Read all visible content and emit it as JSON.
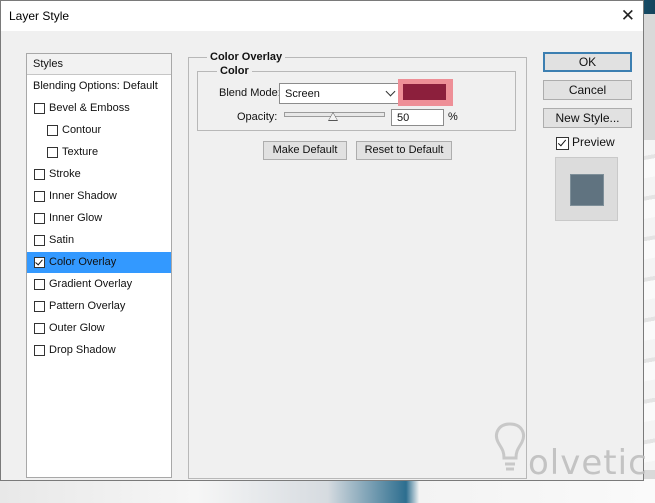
{
  "window": {
    "title": "Layer Style",
    "close_glyph": "✕"
  },
  "styles_panel": {
    "header": "Styles",
    "items": [
      {
        "label": "Blending Options: Default",
        "checkbox": false,
        "checked": false,
        "indent": false,
        "selected": false
      },
      {
        "label": "Bevel & Emboss",
        "checkbox": true,
        "checked": false,
        "indent": false,
        "selected": false
      },
      {
        "label": "Contour",
        "checkbox": true,
        "checked": false,
        "indent": true,
        "selected": false
      },
      {
        "label": "Texture",
        "checkbox": true,
        "checked": false,
        "indent": true,
        "selected": false
      },
      {
        "label": "Stroke",
        "checkbox": true,
        "checked": false,
        "indent": false,
        "selected": false
      },
      {
        "label": "Inner Shadow",
        "checkbox": true,
        "checked": false,
        "indent": false,
        "selected": false
      },
      {
        "label": "Inner Glow",
        "checkbox": true,
        "checked": false,
        "indent": false,
        "selected": false
      },
      {
        "label": "Satin",
        "checkbox": true,
        "checked": false,
        "indent": false,
        "selected": false
      },
      {
        "label": "Color Overlay",
        "checkbox": true,
        "checked": true,
        "indent": false,
        "selected": true
      },
      {
        "label": "Gradient Overlay",
        "checkbox": true,
        "checked": false,
        "indent": false,
        "selected": false
      },
      {
        "label": "Pattern Overlay",
        "checkbox": true,
        "checked": false,
        "indent": false,
        "selected": false
      },
      {
        "label": "Outer Glow",
        "checkbox": true,
        "checked": false,
        "indent": false,
        "selected": false
      },
      {
        "label": "Drop Shadow",
        "checkbox": true,
        "checked": false,
        "indent": false,
        "selected": false
      }
    ]
  },
  "color_overlay": {
    "section_title": "Color Overlay",
    "group_title": "Color",
    "blend_mode_label": "Blend Mode:",
    "blend_mode_value": "Screen",
    "overlay_color": "#8c1f3c",
    "opacity_label": "Opacity:",
    "opacity_value": "50",
    "opacity_unit": "%",
    "make_default": "Make Default",
    "reset_default": "Reset to Default"
  },
  "actions": {
    "ok": "OK",
    "cancel": "Cancel",
    "new_style": "New Style...",
    "preview_label": "Preview",
    "preview_checked": true
  },
  "watermark": {
    "text": "olvetic"
  }
}
